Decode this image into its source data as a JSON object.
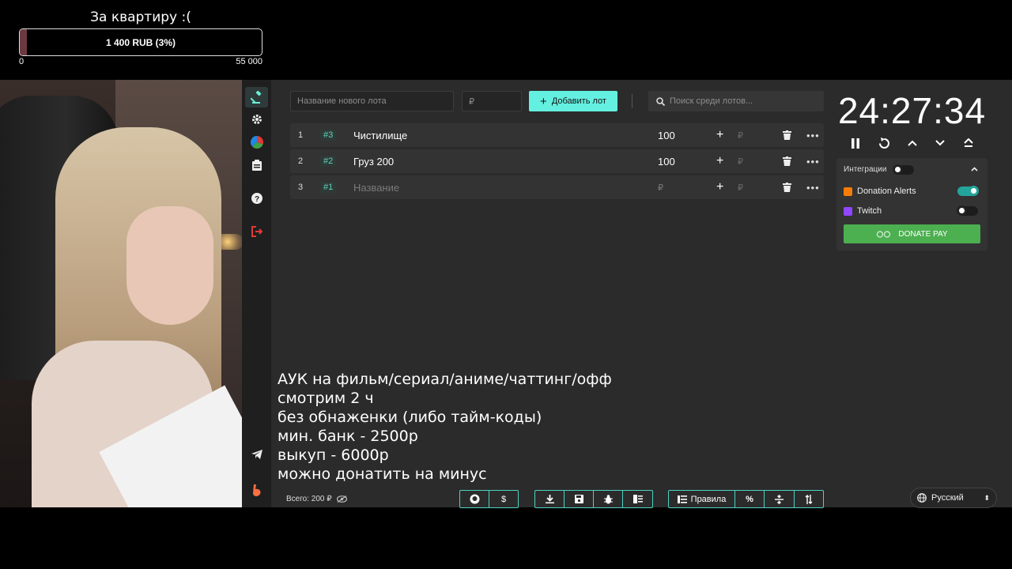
{
  "goal": {
    "title": "За квартиру :(",
    "bar_text": "1 400 RUB (3%)",
    "progress_percent": 3,
    "min_label": "0",
    "max_label": "55 000",
    "fill_color": "#6b3a40"
  },
  "sidebar": {
    "items": [
      {
        "icon": "gavel-icon"
      },
      {
        "icon": "gear-icon"
      },
      {
        "icon": "pie-chart-icon"
      },
      {
        "icon": "clipboard-icon"
      },
      {
        "icon": "help-icon"
      },
      {
        "icon": "logout-icon"
      },
      {
        "icon": "telegram-icon"
      },
      {
        "icon": "logo-icon"
      }
    ]
  },
  "toolbar": {
    "lot_name_placeholder": "Название нового лота",
    "amount_placeholder": "₽",
    "add_label": "Добавить лот",
    "search_placeholder": "Поиск среди лотов..."
  },
  "lots": [
    {
      "num": "1",
      "tag": "#3",
      "name": "Чистилище",
      "amount": "100",
      "rub": "₽"
    },
    {
      "num": "2",
      "tag": "#2",
      "name": "Груз 200",
      "amount": "100",
      "rub": "₽"
    },
    {
      "num": "3",
      "tag": "#1",
      "name": "Название",
      "amount": "₽",
      "rub": "₽"
    }
  ],
  "rules_text": "АУК на фильм/сериал/аниме/чаттинг/офф\nсмотрим 2 ч\nбез обнаженки (либо тайм-коды)\nмин. банк - 2500р\nвыкуп - 6000р\nможно донатить на минус",
  "timer": {
    "value": "24:27:34"
  },
  "integrations": {
    "title": "Интеграции",
    "services": [
      {
        "name": "Donation Alerts",
        "enabled": true,
        "color": "#f57d07"
      },
      {
        "name": "Twitch",
        "enabled": false,
        "color": "#9146ff"
      }
    ],
    "donate_pay_label": "DONATE PAY"
  },
  "footer": {
    "total_label": "Всего: 200 ₽",
    "rules_button": "Правила",
    "language": "Русский"
  },
  "colors": {
    "accent": "#64f0e0",
    "background": "#2b2b2b",
    "sidebar": "#1f1f1f"
  }
}
